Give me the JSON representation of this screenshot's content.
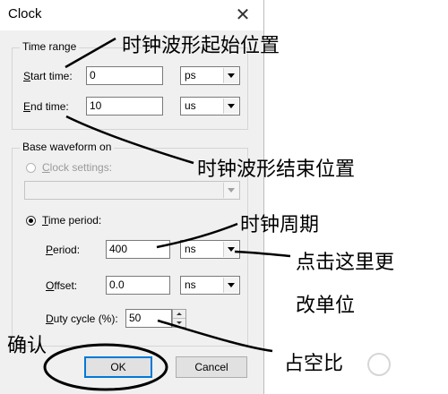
{
  "window": {
    "title": "Clock",
    "close_glyph": "✕"
  },
  "time_range": {
    "title": "Time range",
    "start_label_u": "S",
    "start_label_rest": "tart time:",
    "start_value": "0",
    "start_unit": "ps",
    "end_label_u": "E",
    "end_label_rest": "nd time:",
    "end_value": "10",
    "end_unit": "us"
  },
  "base_waveform": {
    "title": "Base waveform on",
    "clock_settings_u": "C",
    "clock_settings_rest": "lock settings:",
    "clock_settings_value": "",
    "time_period_u": "T",
    "time_period_rest": "ime period:",
    "period_label_u": "P",
    "period_label_rest": "eriod:",
    "period_value": "400",
    "period_unit": "ns",
    "offset_label_u": "O",
    "offset_label_rest": "ffset:",
    "offset_value": "0.0",
    "offset_unit": "ns",
    "duty_label_u": "D",
    "duty_label_rest": "uty cycle (%):",
    "duty_value": "50"
  },
  "buttons": {
    "ok": "OK",
    "cancel": "Cancel"
  },
  "annotations": {
    "start_position": "时钟波形起始位置",
    "end_position": "时钟波形结束位置",
    "clock_period": "时钟周期",
    "change_unit_line1": "点击这里更",
    "change_unit_line2": "改单位",
    "confirm": "确认",
    "duty_ratio": "占空比"
  },
  "icons": {
    "close": "close-icon",
    "dropdown": "chevron-down-icon",
    "spinner": "spinner-arrows-icon",
    "watermark": "watermark-logo"
  }
}
